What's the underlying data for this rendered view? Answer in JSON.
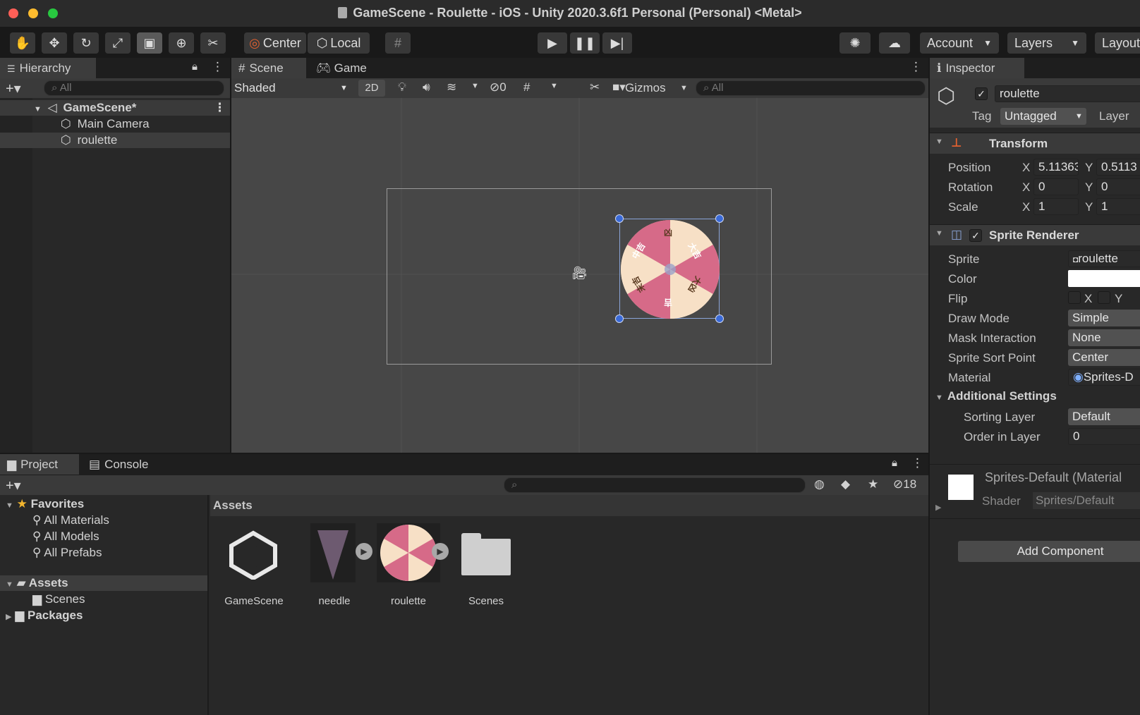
{
  "window": {
    "title": "GameScene - Roulette - iOS - Unity 2020.3.6f1 Personal (Personal) <Metal>"
  },
  "toolbar": {
    "pivot_label": "Center",
    "space_label": "Local",
    "account_label": "Account",
    "layers_label": "Layers",
    "layout_label": "Layout"
  },
  "hierarchy": {
    "tab_label": "Hierarchy",
    "search_placeholder": "All",
    "scene_name": "GameScene*",
    "items": [
      {
        "label": "Main Camera"
      },
      {
        "label": "roulette"
      }
    ]
  },
  "scene_view": {
    "tabs": [
      {
        "label": "Scene"
      },
      {
        "label": "Game"
      }
    ],
    "shading": "Shaded",
    "mode_2d": "2D",
    "hidden_count": "0",
    "gizmos_label": "Gizmos",
    "search_placeholder": "All",
    "wheel_segments": [
      "凶",
      "大吉",
      "大凶",
      "吉",
      "末吉",
      "中吉"
    ]
  },
  "inspector": {
    "tab_label": "Inspector",
    "object_name": "roulette",
    "tag_label": "Tag",
    "tag_value": "Untagged",
    "layer_label": "Layer",
    "transform": {
      "title": "Transform",
      "position_label": "Position",
      "position_x": "5.11363",
      "position_y": "0.5113",
      "rotation_label": "Rotation",
      "rotation_x": "0",
      "rotation_y": "0",
      "scale_label": "Scale",
      "scale_x": "1",
      "scale_y": "1",
      "x_label": "X",
      "y_label": "Y"
    },
    "sprite_renderer": {
      "title": "Sprite Renderer",
      "sprite_label": "Sprite",
      "sprite_value": "roulette",
      "color_label": "Color",
      "flip_label": "Flip",
      "flip_x": "X",
      "flip_y": "Y",
      "draw_mode_label": "Draw Mode",
      "draw_mode_value": "Simple",
      "mask_label": "Mask Interaction",
      "mask_value": "None",
      "sort_point_label": "Sprite Sort Point",
      "sort_point_value": "Center",
      "material_label": "Material",
      "material_value": "Sprites-D",
      "additional_title": "Additional Settings",
      "sorting_layer_label": "Sorting Layer",
      "sorting_layer_value": "Default",
      "order_label": "Order in Layer",
      "order_value": "0"
    },
    "material": {
      "name": "Sprites-Default (Material",
      "shader_label": "Shader",
      "shader_value": "Sprites/Default"
    },
    "add_component_label": "Add Component"
  },
  "project": {
    "tabs": [
      {
        "label": "Project"
      },
      {
        "label": "Console"
      }
    ],
    "hidden_count": "18",
    "favorites_label": "Favorites",
    "favorites": [
      {
        "label": "All Materials"
      },
      {
        "label": "All Models"
      },
      {
        "label": "All Prefabs"
      }
    ],
    "assets_label": "Assets",
    "assets_children": [
      {
        "label": "Scenes"
      }
    ],
    "packages_label": "Packages",
    "breadcrumb": "Assets",
    "asset_items": [
      {
        "label": "GameScene"
      },
      {
        "label": "needle"
      },
      {
        "label": "roulette"
      },
      {
        "label": "Scenes"
      }
    ]
  }
}
